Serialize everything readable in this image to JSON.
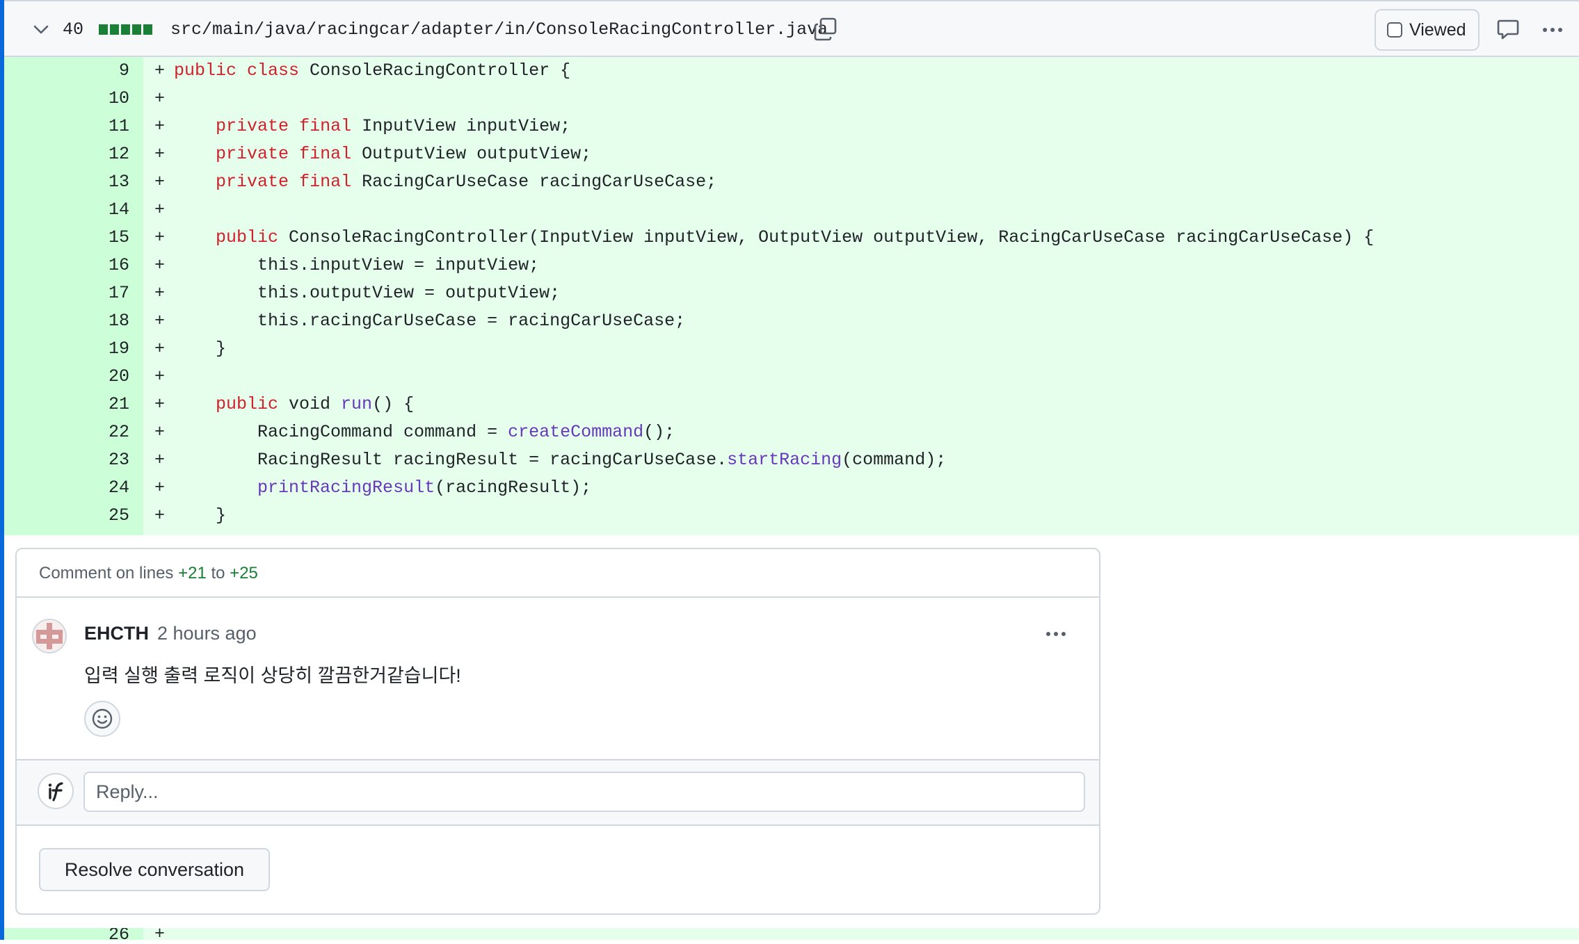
{
  "file": {
    "diff_count": "40",
    "path": "src/main/java/racingcar/adapter/in/ConsoleRacingController.java",
    "viewed_label": "Viewed"
  },
  "diff": {
    "lines": [
      {
        "num": "9",
        "sign": "+",
        "tokens": [
          {
            "t": "public",
            "c": "k"
          },
          {
            "t": " "
          },
          {
            "t": "class",
            "c": "k"
          },
          {
            "t": " ConsoleRacingController {"
          }
        ]
      },
      {
        "num": "10",
        "sign": "+",
        "tokens": []
      },
      {
        "num": "11",
        "sign": "+",
        "tokens": [
          {
            "t": "    "
          },
          {
            "t": "private",
            "c": "k"
          },
          {
            "t": " "
          },
          {
            "t": "final",
            "c": "k"
          },
          {
            "t": " InputView inputView;"
          }
        ]
      },
      {
        "num": "12",
        "sign": "+",
        "tokens": [
          {
            "t": "    "
          },
          {
            "t": "private",
            "c": "k"
          },
          {
            "t": " "
          },
          {
            "t": "final",
            "c": "k"
          },
          {
            "t": " OutputView outputView;"
          }
        ]
      },
      {
        "num": "13",
        "sign": "+",
        "tokens": [
          {
            "t": "    "
          },
          {
            "t": "private",
            "c": "k"
          },
          {
            "t": " "
          },
          {
            "t": "final",
            "c": "k"
          },
          {
            "t": " RacingCarUseCase racingCarUseCase;"
          }
        ]
      },
      {
        "num": "14",
        "sign": "+",
        "tokens": []
      },
      {
        "num": "15",
        "sign": "+",
        "tokens": [
          {
            "t": "    "
          },
          {
            "t": "public",
            "c": "k"
          },
          {
            "t": " ConsoleRacingController(InputView inputView, OutputView outputView, RacingCarUseCase racingCarUseCase) {"
          }
        ]
      },
      {
        "num": "16",
        "sign": "+",
        "tokens": [
          {
            "t": "        this.inputView = inputView;"
          }
        ]
      },
      {
        "num": "17",
        "sign": "+",
        "tokens": [
          {
            "t": "        this.outputView = outputView;"
          }
        ]
      },
      {
        "num": "18",
        "sign": "+",
        "tokens": [
          {
            "t": "        this.racingCarUseCase = racingCarUseCase;"
          }
        ]
      },
      {
        "num": "19",
        "sign": "+",
        "tokens": [
          {
            "t": "    }"
          }
        ]
      },
      {
        "num": "20",
        "sign": "+",
        "tokens": []
      },
      {
        "num": "21",
        "sign": "+",
        "tokens": [
          {
            "t": "    "
          },
          {
            "t": "public",
            "c": "k"
          },
          {
            "t": " void "
          },
          {
            "t": "run",
            "c": "f"
          },
          {
            "t": "() {"
          }
        ]
      },
      {
        "num": "22",
        "sign": "+",
        "tokens": [
          {
            "t": "        RacingCommand command = "
          },
          {
            "t": "createCommand",
            "c": "f"
          },
          {
            "t": "();"
          }
        ]
      },
      {
        "num": "23",
        "sign": "+",
        "tokens": [
          {
            "t": "        RacingResult racingResult = racingCarUseCase."
          },
          {
            "t": "startRacing",
            "c": "f"
          },
          {
            "t": "(command);"
          }
        ]
      },
      {
        "num": "24",
        "sign": "+",
        "tokens": [
          {
            "t": "        "
          },
          {
            "t": "printRacingResult",
            "c": "f"
          },
          {
            "t": "(racingResult);"
          }
        ]
      },
      {
        "num": "25",
        "sign": "+",
        "tokens": [
          {
            "t": "    }"
          }
        ]
      }
    ],
    "next_line_num": "26",
    "next_line_sign": "+"
  },
  "thread": {
    "header_prefix": "Comment on lines ",
    "line_start": "+21",
    "to_word": " to ",
    "line_end": "+25",
    "author": "EHCTH",
    "time": "2 hours ago",
    "body": "입력 실행 출력 로직이 상당히 깔끔한거같습니다!",
    "reply_placeholder": "Reply...",
    "resolve_label": "Resolve conversation"
  },
  "colors": {
    "addition_bg": "#e6ffec",
    "addition_gutter": "#ccffd8",
    "keyword": "#cf222e",
    "function": "#6639ba",
    "accent": "#0969da",
    "green": "#1a7f37"
  }
}
